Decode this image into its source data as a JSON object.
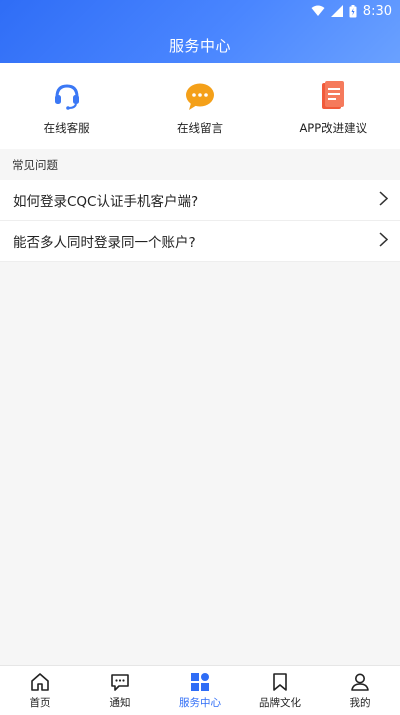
{
  "status": {
    "time": "8:30"
  },
  "header": {
    "title": "服务中心"
  },
  "actions": [
    {
      "label": "在线客服",
      "icon": "headset-icon",
      "color": "#3b78f5"
    },
    {
      "label": "在线留言",
      "icon": "chat-bubble-icon",
      "color": "#f4a019"
    },
    {
      "label": "APP改进建议",
      "icon": "document-icon",
      "color": "#f15a3a"
    }
  ],
  "faq": {
    "title": "常见问题",
    "items": [
      {
        "question": "如何登录CQC认证手机客户端?"
      },
      {
        "question": "能否多人同时登录同一个账户?"
      }
    ]
  },
  "tabbar": {
    "active_color": "#2f6df6",
    "items": [
      {
        "label": "首页",
        "icon": "home-icon"
      },
      {
        "label": "通知",
        "icon": "message-icon"
      },
      {
        "label": "服务中心",
        "icon": "grid-icon",
        "active": true
      },
      {
        "label": "品牌文化",
        "icon": "bookmark-icon"
      },
      {
        "label": "我的",
        "icon": "user-icon"
      }
    ]
  }
}
